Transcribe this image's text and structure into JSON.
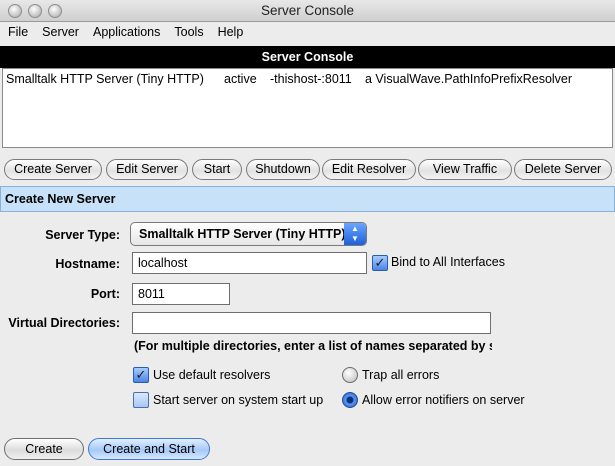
{
  "window": {
    "title": "Server Console"
  },
  "menu": [
    "File",
    "Server",
    "Applications",
    "Tools",
    "Help"
  ],
  "console": {
    "header": "Server Console",
    "servers": [
      {
        "name": "Smalltalk HTTP Server (Tiny HTTP)",
        "status": "active",
        "host": "-thishost-:8011",
        "resolver": "a VisualWave.PathInfoPrefixResolver"
      }
    ]
  },
  "actions": {
    "create_server": "Create Server",
    "edit_server": "Edit Server",
    "start": "Start",
    "shutdown": "Shutdown",
    "edit_resolver": "Edit Resolver",
    "view_traffic": "View Traffic",
    "delete_server": "Delete Server"
  },
  "form": {
    "section_title": "Create New Server",
    "server_type_label": "Server Type:",
    "server_type_value": "Smalltalk HTTP Server (Tiny HTTP)",
    "hostname_label": "Hostname:",
    "hostname_value": "localhost",
    "bind_all_label": "Bind to All Interfaces",
    "port_label": "Port:",
    "port_value": "8011",
    "virtual_dirs_label": "Virtual Directories:",
    "virtual_dirs_value": "",
    "hint": "(For multiple directories, enter a list of names separated by ser",
    "use_default_resolvers": "Use default resolvers",
    "start_on_startup": "Start server on system start up",
    "trap_all_errors": "Trap all errors",
    "allow_error_notifiers": "Allow error notifiers on server"
  },
  "footer": {
    "create": "Create",
    "create_and_start": "Create and Start"
  }
}
